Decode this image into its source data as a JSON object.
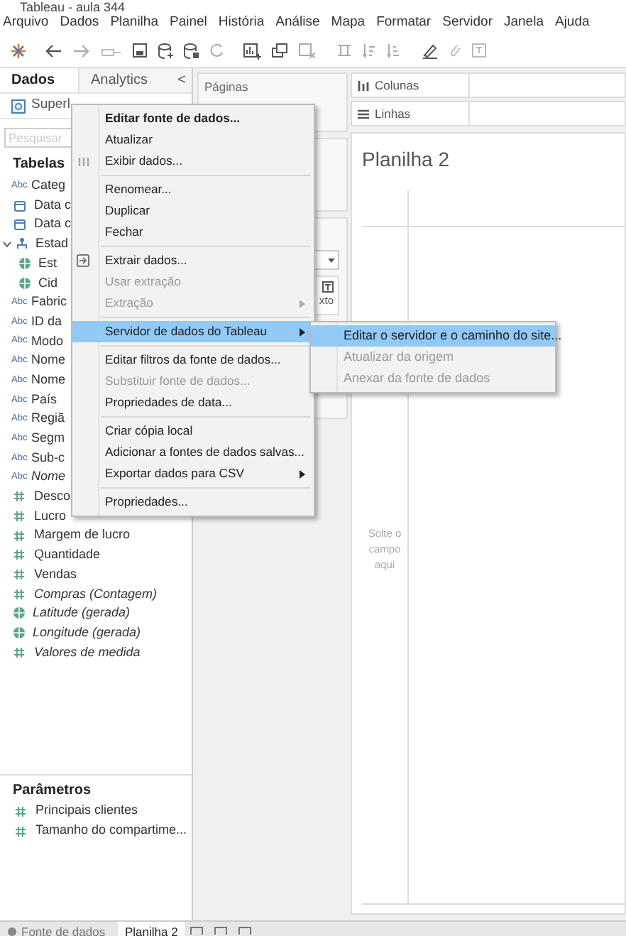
{
  "window": {
    "title": "Tableau - aula 344"
  },
  "menu_bar": [
    "Arquivo",
    "Dados",
    "Planilha",
    "Painel",
    "História",
    "Análise",
    "Mapa",
    "Formatar",
    "Servidor",
    "Janela",
    "Ajuda"
  ],
  "side_tabs": [
    {
      "label": "Dados",
      "selected": true
    },
    {
      "label": "Analytics",
      "selected": false
    }
  ],
  "collapse_glyph": "<",
  "data_source": {
    "name": "Superl"
  },
  "search": {
    "placeholder": "Pesquisar"
  },
  "tables_heading": "Tabelas",
  "fields": [
    {
      "kind": "text",
      "icon_text": "Abc",
      "label": "Categ",
      "italic": false
    },
    {
      "kind": "date",
      "label": "Data c",
      "italic": false
    },
    {
      "kind": "date",
      "label": "Data c",
      "italic": false
    },
    {
      "kind": "hierarchy",
      "label": "Estad",
      "italic": false,
      "expanded": true,
      "children": [
        {
          "kind": "geo",
          "label": "Est",
          "italic": false
        },
        {
          "kind": "geo",
          "label": "Cid",
          "italic": false
        }
      ]
    },
    {
      "kind": "text",
      "icon_text": "Abc",
      "label": "Fabric",
      "italic": false
    },
    {
      "kind": "text",
      "icon_text": "Abc",
      "label": "ID da",
      "italic": false
    },
    {
      "kind": "text",
      "icon_text": "Abc",
      "label": "Modo",
      "italic": false
    },
    {
      "kind": "text",
      "icon_text": "Abc",
      "label": "Nome",
      "italic": false
    },
    {
      "kind": "text",
      "icon_text": "Abc",
      "label": "Nome",
      "italic": false
    },
    {
      "kind": "text",
      "icon_text": "Abc",
      "label": "País",
      "italic": false
    },
    {
      "kind": "text",
      "icon_text": "Abc",
      "label": "Regiã",
      "italic": false
    },
    {
      "kind": "text",
      "icon_text": "Abc",
      "label": "Segm",
      "italic": false
    },
    {
      "kind": "text",
      "icon_text": "Abc",
      "label": "Sub-c",
      "italic": false
    },
    {
      "kind": "text",
      "icon_text": "Abc",
      "label": "Nome",
      "italic": true
    },
    {
      "kind": "number",
      "label": "Desco",
      "italic": false
    },
    {
      "kind": "number",
      "label": "Lucro",
      "italic": false
    },
    {
      "kind": "number",
      "label": "Margem de lucro",
      "italic": false
    },
    {
      "kind": "number",
      "label": "Quantidade",
      "italic": false
    },
    {
      "kind": "number",
      "label": "Vendas",
      "italic": false
    },
    {
      "kind": "number",
      "label": "Compras (Contagem)",
      "italic": true
    },
    {
      "kind": "geo",
      "label": "Latitude (gerada)",
      "italic": true
    },
    {
      "kind": "geo",
      "label": "Longitude (gerada)",
      "italic": true
    },
    {
      "kind": "number",
      "label": "Valores de medida",
      "italic": true
    }
  ],
  "parameters": {
    "heading": "Parâmetros",
    "items": [
      {
        "label": "Principais clientes"
      },
      {
        "label": "Tamanho do compartime..."
      }
    ]
  },
  "pages_card": {
    "title": "Páginas"
  },
  "marks_card": {
    "button_label": "xto"
  },
  "shelves": [
    {
      "kind": "columns",
      "label": "Colunas"
    },
    {
      "kind": "rows",
      "label": "Linhas"
    }
  ],
  "sheet": {
    "title": "Planilha 2",
    "drop_hint": "Solte o campo aqui"
  },
  "context_menu": [
    {
      "kind": "default",
      "label": "Editar fonte de dados...",
      "disabled": false,
      "selected": false,
      "submenu": false
    },
    {
      "kind": "item",
      "label": "Atualizar",
      "disabled": false,
      "selected": false,
      "submenu": false
    },
    {
      "kind": "grid",
      "label": "Exibir dados...",
      "disabled": false,
      "selected": false,
      "submenu": false
    },
    {
      "kind": "separator"
    },
    {
      "kind": "item",
      "label": "Renomear...",
      "disabled": false,
      "selected": false,
      "submenu": false
    },
    {
      "kind": "item",
      "label": "Duplicar",
      "disabled": false,
      "selected": false,
      "submenu": false
    },
    {
      "kind": "item",
      "label": "Fechar",
      "disabled": false,
      "selected": false,
      "submenu": false
    },
    {
      "kind": "separator"
    },
    {
      "kind": "extract",
      "label": "Extrair dados...",
      "disabled": false,
      "selected": false,
      "submenu": false
    },
    {
      "kind": "item",
      "label": "Usar extração",
      "disabled": true,
      "selected": false,
      "submenu": false
    },
    {
      "kind": "item",
      "label": "Extração",
      "disabled": true,
      "selected": false,
      "submenu": true
    },
    {
      "kind": "separator"
    },
    {
      "kind": "item",
      "label": "Servidor de dados do Tableau",
      "disabled": false,
      "selected": true,
      "submenu": true
    },
    {
      "kind": "separator"
    },
    {
      "kind": "item",
      "label": "Editar filtros da fonte de dados...",
      "disabled": false,
      "selected": false,
      "submenu": false
    },
    {
      "kind": "item",
      "label": "Substituir fonte de dados...",
      "disabled": true,
      "selected": false,
      "submenu": false
    },
    {
      "kind": "item",
      "label": "Propriedades de data...",
      "disabled": false,
      "selected": false,
      "submenu": false
    },
    {
      "kind": "separator"
    },
    {
      "kind": "item",
      "label": "Criar cópia local",
      "disabled": false,
      "selected": false,
      "submenu": false
    },
    {
      "kind": "item",
      "label": "Adicionar a fontes de dados salvas...",
      "disabled": false,
      "selected": false,
      "submenu": false
    },
    {
      "kind": "item",
      "label": "Exportar dados para CSV",
      "disabled": false,
      "selected": false,
      "submenu": true
    },
    {
      "kind": "separator"
    },
    {
      "kind": "item",
      "label": "Propriedades...",
      "disabled": false,
      "selected": false,
      "submenu": false
    }
  ],
  "submenu": [
    {
      "label": "Editar o servidor e o caminho do site...",
      "disabled": false,
      "selected": true
    },
    {
      "label": "Atualizar da origem",
      "disabled": true,
      "selected": false
    },
    {
      "label": "Anexar da fonte de dados",
      "disabled": true,
      "selected": false
    }
  ],
  "sheet_tabs": [
    {
      "kind": "source",
      "label": "Fonte de dados",
      "selected": false
    },
    {
      "kind": "sheet",
      "label": "Planilha 2",
      "selected": true
    }
  ]
}
